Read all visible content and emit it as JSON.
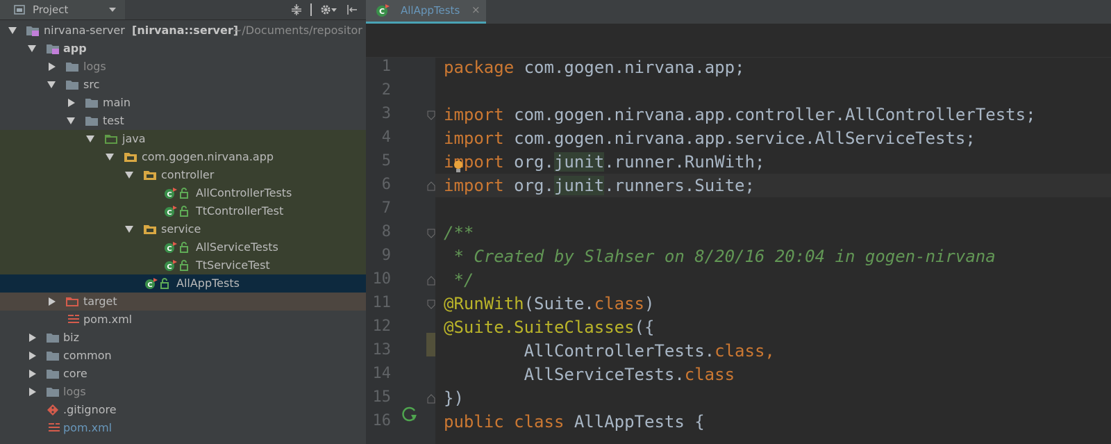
{
  "project_panel": {
    "title": "Project",
    "tree": [
      {
        "text": "nirvana-server",
        "bold_suffix": "[nirvana::server]",
        "path": "~/Documents/repositor"
      },
      {
        "text": "app"
      },
      {
        "text": "logs"
      },
      {
        "text": "src"
      },
      {
        "text": "main"
      },
      {
        "text": "test"
      },
      {
        "text": "java"
      },
      {
        "text": "com.gogen.nirvana.app"
      },
      {
        "text": "controller"
      },
      {
        "text": "AllControllerTests"
      },
      {
        "text": "TtControllerTest"
      },
      {
        "text": "service"
      },
      {
        "text": "AllServiceTests"
      },
      {
        "text": "TtServiceTest"
      },
      {
        "text": "AllAppTests"
      },
      {
        "text": "target"
      },
      {
        "text": "pom.xml"
      },
      {
        "text": "biz"
      },
      {
        "text": "common"
      },
      {
        "text": "core"
      },
      {
        "text": "logs"
      },
      {
        "text": ".gitignore"
      },
      {
        "text": "pom.xml"
      }
    ]
  },
  "editor": {
    "tab_label": "AllAppTests",
    "tab_close": "×",
    "line_numbers": [
      "1",
      "2",
      "3",
      "4",
      "5",
      "6",
      "7",
      "8",
      "9",
      "10",
      "11",
      "12",
      "13",
      "14",
      "15",
      "16"
    ],
    "code": {
      "l1_kw": "package",
      "l1_rest": " com.gogen.nirvana.app;",
      "l3_kw": "import",
      "l3_rest": " com.gogen.nirvana.app.controller.AllControllerTests;",
      "l4_kw": "import",
      "l4_rest": " com.gogen.nirvana.app.service.AllServiceTests;",
      "l5_kw": "import",
      "l5_a": " org.",
      "l5_hl": "junit",
      "l5_b": ".runner.RunWith;",
      "l6_kw": "import",
      "l6_a": " org.",
      "l6_hl": "junit",
      "l6_b": ".runners.Suite;",
      "l8": "/**",
      "l9": " * Created by Slahser on 8/20/16 20:04 in gogen-nirvana",
      "l10": " */",
      "l11_ann": "@RunWith",
      "l11_a": "(Suite.",
      "l11_kw": "class",
      "l11_b": ")",
      "l12_ann": "@Suite.SuiteClasses",
      "l12_a": "({",
      "l13_a": "        AllControllerTests.",
      "l13_kw": "class",
      "l13_b": ",",
      "l14_a": "        AllServiceTests.",
      "l14_kw": "class",
      "l15": "})",
      "l16_kw1": "public",
      "l16_kw2": "class",
      "l16_a": " AllAppTests {"
    }
  },
  "colors": {
    "keyword": "#cc7832",
    "annotation": "#bbb529",
    "comment": "#629755",
    "text": "#a9b7c6",
    "line_number": "#606366"
  }
}
